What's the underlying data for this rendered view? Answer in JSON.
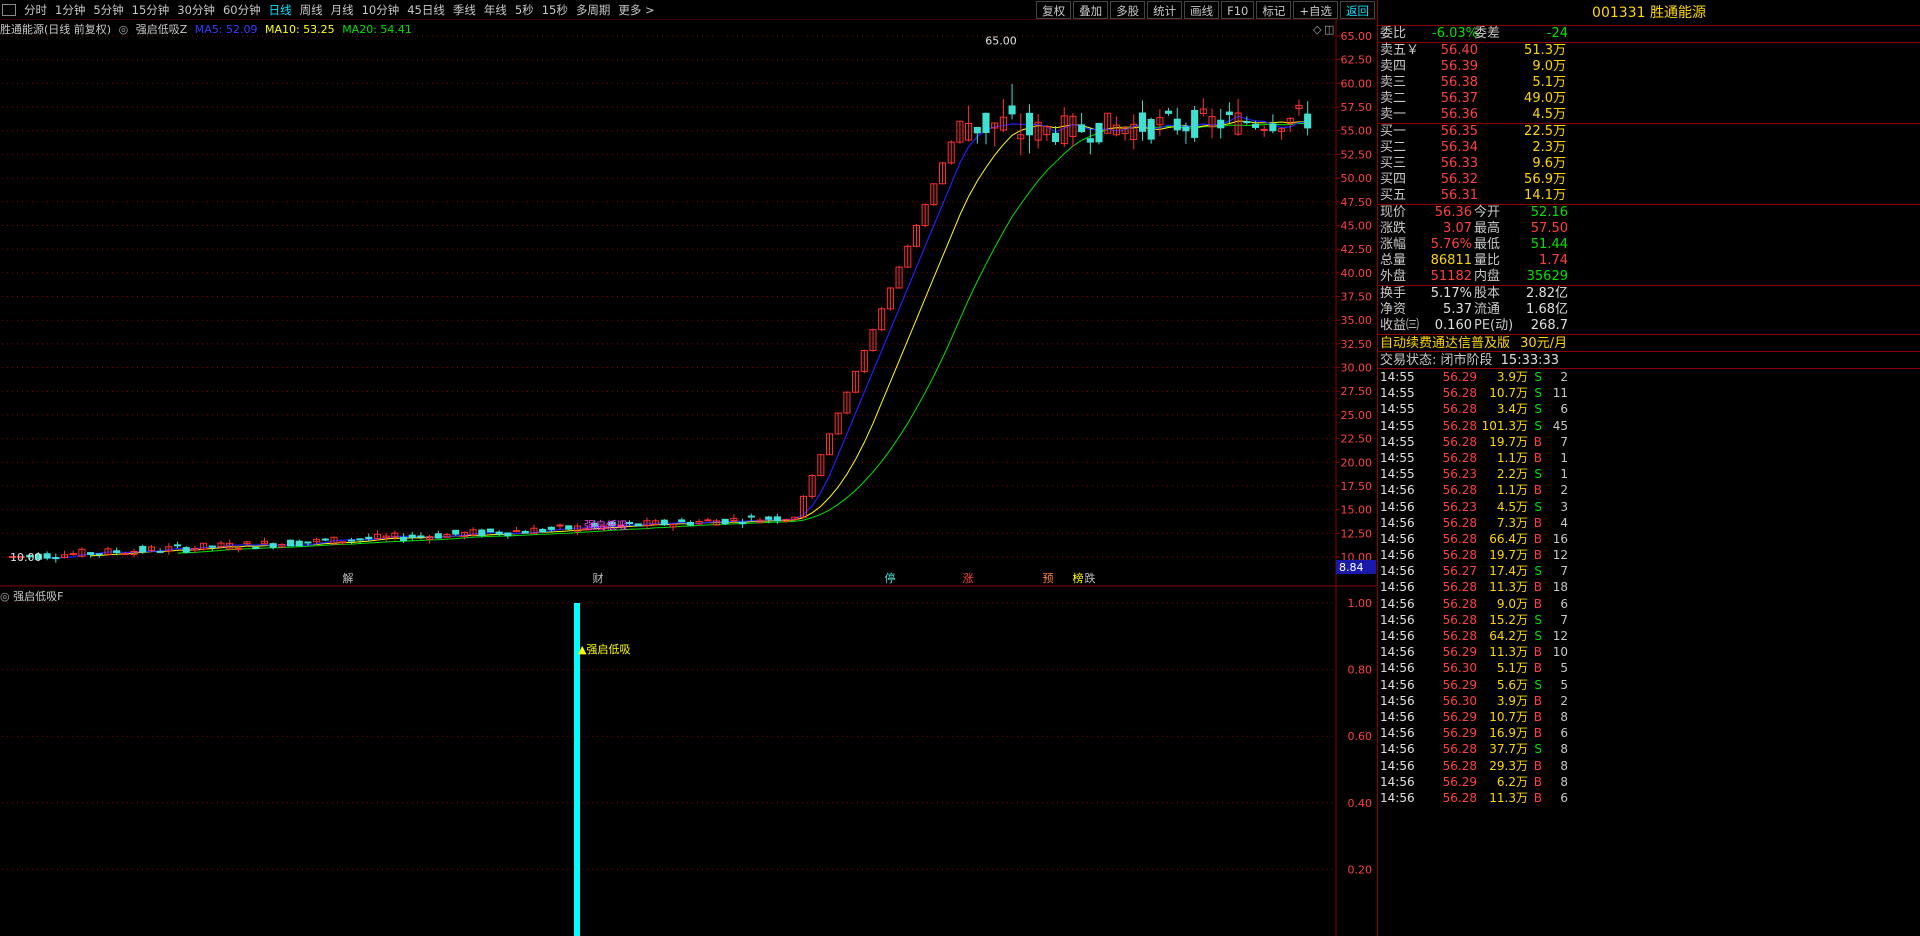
{
  "toolbar": {
    "periods": [
      "分时",
      "1分钟",
      "5分钟",
      "15分钟",
      "30分钟",
      "60分钟",
      "日线",
      "周线",
      "月线",
      "10分钟",
      "45日线",
      "季线",
      "年线",
      "5秒",
      "15秒",
      "多周期",
      "更多 >"
    ],
    "active_period": "日线",
    "right_buttons": [
      "复权",
      "叠加",
      "多股",
      "统计",
      "画线",
      "F10",
      "标记",
      "+自选",
      "返回"
    ],
    "active_right": "返回"
  },
  "main_title": {
    "stock": "胜通能源(日线 前复权)",
    "indicator": "强启低吸Z",
    "ma5": "MA5: 52.09",
    "ma10": "MA10: 53.25",
    "ma20": "MA20: 54.41"
  },
  "colors": {
    "up": "#ff3030",
    "down": "#40e0d0",
    "ma5": "#2020ff",
    "ma10": "#ffff00",
    "ma20": "#00e000",
    "grid": "#8b0000"
  },
  "chart_data": {
    "type": "candlestick",
    "ylim": [
      8.84,
      65.0
    ],
    "y_ticks": [
      "65.00",
      "62.50",
      "60.00",
      "57.50",
      "55.00",
      "52.50",
      "50.00",
      "47.50",
      "45.00",
      "42.50",
      "40.00",
      "37.50",
      "35.00",
      "32.50",
      "30.00",
      "27.50",
      "25.00",
      "22.50",
      "20.00",
      "17.50",
      "15.00",
      "12.50",
      "10.00"
    ],
    "max_label": "65.00",
    "min_label": "10.00",
    "current_marker": "8.84",
    "event_markers": [
      "解",
      "财",
      "停",
      "涨",
      "预",
      "榜",
      "跌"
    ],
    "signal_label": "强启低吸",
    "phases": [
      {
        "count": 90,
        "from": 10.0,
        "to": 14.2,
        "noise": 0.9
      },
      {
        "count": 20,
        "from": 14.2,
        "to": 56.0,
        "noise": 0.5,
        "limit_up": true
      },
      {
        "count": 8,
        "from": 56.0,
        "to": 55.0,
        "noise": 5.0
      },
      {
        "count": 32,
        "from": 55.0,
        "to": 56.36,
        "noise": 3.0
      }
    ]
  },
  "sub_chart": {
    "title": "强启低吸F",
    "y_ticks": [
      "1.00",
      "0.80",
      "0.60",
      "0.40",
      "0.20"
    ],
    "signal_label": "强启低吸",
    "signal_value": 1.0
  },
  "quote": {
    "code_name": "001331 胜通能源",
    "wei_bi_label": "委比",
    "wei_bi": "-6.03%",
    "wei_cha_label": "委差",
    "wei_cha": "-24",
    "asks": [
      {
        "label": "卖五￥",
        "price": "56.40",
        "vol": "51.3万"
      },
      {
        "label": "卖四",
        "price": "56.39",
        "vol": "9.0万"
      },
      {
        "label": "卖三",
        "price": "56.38",
        "vol": "5.1万"
      },
      {
        "label": "卖二",
        "price": "56.37",
        "vol": "49.0万"
      },
      {
        "label": "卖一",
        "price": "56.36",
        "vol": "4.5万"
      }
    ],
    "bids": [
      {
        "label": "买一",
        "price": "56.35",
        "vol": "22.5万"
      },
      {
        "label": "买二",
        "price": "56.34",
        "vol": "2.3万"
      },
      {
        "label": "买三",
        "price": "56.33",
        "vol": "9.6万"
      },
      {
        "label": "买四",
        "price": "56.32",
        "vol": "56.9万"
      },
      {
        "label": "买五",
        "price": "56.31",
        "vol": "14.1万"
      }
    ],
    "stats1": [
      {
        "l1": "现价",
        "v1": "56.36",
        "c1": "red",
        "l2": "今开",
        "v2": "52.16",
        "c2": "green"
      },
      {
        "l1": "涨跌",
        "v1": "3.07",
        "c1": "red",
        "l2": "最高",
        "v2": "57.50",
        "c2": "red"
      },
      {
        "l1": "涨幅",
        "v1": "5.76%",
        "c1": "red",
        "l2": "最低",
        "v2": "51.44",
        "c2": "green"
      },
      {
        "l1": "总量",
        "v1": "86811",
        "c1": "yellow",
        "l2": "量比",
        "v2": "1.74",
        "c2": "red"
      },
      {
        "l1": "外盘",
        "v1": "51182",
        "c1": "red",
        "l2": "内盘",
        "v2": "35629",
        "c2": "green"
      }
    ],
    "stats2": [
      {
        "l1": "换手",
        "v1": "5.17%",
        "c1": "white",
        "l2": "股本",
        "v2": "2.82亿",
        "c2": "white"
      },
      {
        "l1": "净资",
        "v1": "5.37",
        "c1": "white",
        "l2": "流通",
        "v2": "1.68亿",
        "c2": "white"
      },
      {
        "l1": "收益㈢",
        "v1": "0.160",
        "c1": "white",
        "l2": "PE(动)",
        "v2": "268.7",
        "c2": "white"
      }
    ],
    "promo": "自动续费通达信普及版",
    "promo_price": "30元/月",
    "trade_state": "交易状态: 闭市阶段",
    "trade_time": "15:33:33"
  },
  "ticks": [
    {
      "t": "14:55",
      "p": "56.29",
      "v": "3.9万",
      "d": "S",
      "n": "2"
    },
    {
      "t": "14:55",
      "p": "56.28",
      "v": "10.7万",
      "d": "S",
      "n": "11"
    },
    {
      "t": "14:55",
      "p": "56.28",
      "v": "3.4万",
      "d": "S",
      "n": "6"
    },
    {
      "t": "14:55",
      "p": "56.28",
      "v": "101.3万",
      "d": "S",
      "n": "45"
    },
    {
      "t": "14:55",
      "p": "56.28",
      "v": "19.7万",
      "d": "B",
      "n": "7"
    },
    {
      "t": "14:55",
      "p": "56.28",
      "v": "1.1万",
      "d": "B",
      "n": "1"
    },
    {
      "t": "14:55",
      "p": "56.23",
      "v": "2.2万",
      "d": "S",
      "n": "1"
    },
    {
      "t": "14:56",
      "p": "56.28",
      "v": "1.1万",
      "d": "B",
      "n": "2"
    },
    {
      "t": "14:56",
      "p": "56.23",
      "v": "4.5万",
      "d": "S",
      "n": "3"
    },
    {
      "t": "14:56",
      "p": "56.28",
      "v": "7.3万",
      "d": "B",
      "n": "4"
    },
    {
      "t": "14:56",
      "p": "56.28",
      "v": "66.4万",
      "d": "B",
      "n": "16"
    },
    {
      "t": "14:56",
      "p": "56.28",
      "v": "19.7万",
      "d": "B",
      "n": "12"
    },
    {
      "t": "14:56",
      "p": "56.27",
      "v": "17.4万",
      "d": "S",
      "n": "7"
    },
    {
      "t": "14:56",
      "p": "56.28",
      "v": "11.3万",
      "d": "B",
      "n": "18"
    },
    {
      "t": "14:56",
      "p": "56.28",
      "v": "9.0万",
      "d": "B",
      "n": "6"
    },
    {
      "t": "14:56",
      "p": "56.28",
      "v": "15.2万",
      "d": "S",
      "n": "7"
    },
    {
      "t": "14:56",
      "p": "56.28",
      "v": "64.2万",
      "d": "S",
      "n": "12"
    },
    {
      "t": "14:56",
      "p": "56.29",
      "v": "11.3万",
      "d": "B",
      "n": "10"
    },
    {
      "t": "14:56",
      "p": "56.30",
      "v": "5.1万",
      "d": "B",
      "n": "5"
    },
    {
      "t": "14:56",
      "p": "56.29",
      "v": "5.6万",
      "d": "S",
      "n": "5"
    },
    {
      "t": "14:56",
      "p": "56.30",
      "v": "3.9万",
      "d": "B",
      "n": "2"
    },
    {
      "t": "14:56",
      "p": "56.29",
      "v": "10.7万",
      "d": "B",
      "n": "8"
    },
    {
      "t": "14:56",
      "p": "56.29",
      "v": "16.9万",
      "d": "B",
      "n": "6"
    },
    {
      "t": "14:56",
      "p": "56.28",
      "v": "37.7万",
      "d": "S",
      "n": "8"
    },
    {
      "t": "14:56",
      "p": "56.28",
      "v": "29.3万",
      "d": "B",
      "n": "8"
    },
    {
      "t": "14:56",
      "p": "56.29",
      "v": "6.2万",
      "d": "B",
      "n": "8"
    },
    {
      "t": "14:56",
      "p": "56.28",
      "v": "11.3万",
      "d": "B",
      "n": "6"
    }
  ]
}
